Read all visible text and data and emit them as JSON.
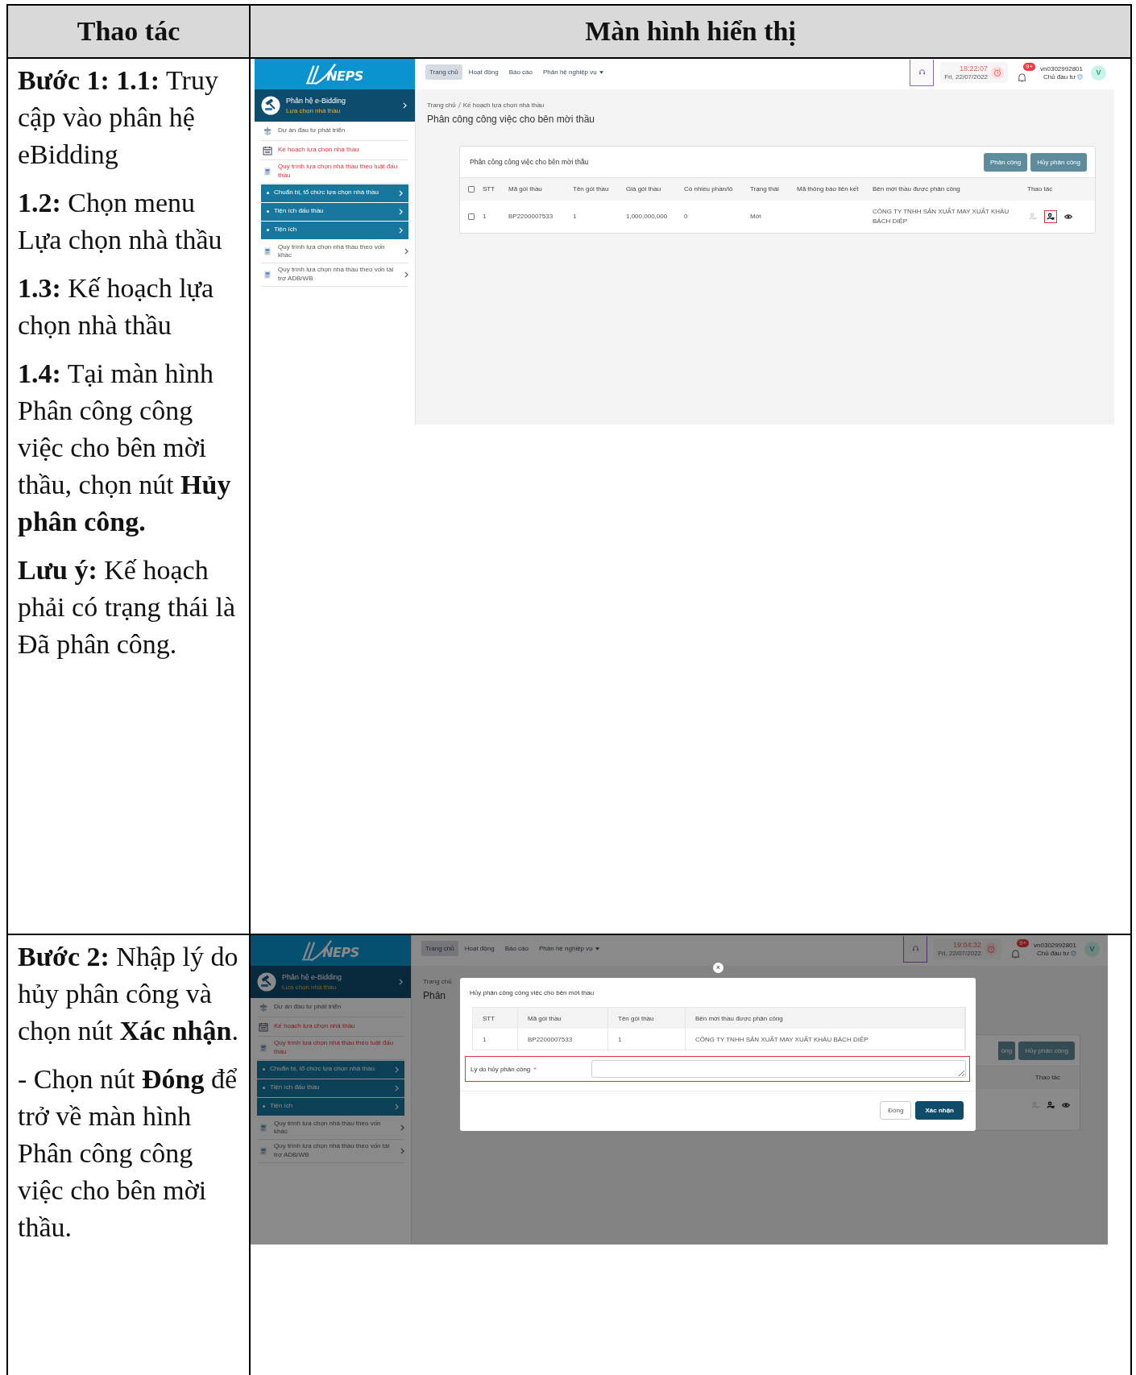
{
  "table": {
    "columns": [
      "Thao tác",
      "Màn hình hiển thị"
    ],
    "rows": [
      {
        "instructions": [
          "**Bước 1: 1.1:** Truy cập vào phân hệ eBidding",
          "**1.2:** Chọn menu Lựa chọn nhà thầu",
          "**1.3:** Kế hoạch lựa chọn nhà thầu",
          "**1.4:** Tại màn hình Phân công công việc cho bên mời thầu, chọn nút **Hủy phân công.**",
          "**Lưu ý:**  Kế hoạch phải có trạng thái là Đã phân công."
        ],
        "screen": {
          "kind": "page",
          "logo": "NEPS",
          "nav": [
            {
              "label": "Trang chủ",
              "selected": true,
              "dropdown": false
            },
            {
              "label": "Hoạt động",
              "selected": false,
              "dropdown": false
            },
            {
              "label": "Báo cáo",
              "selected": false,
              "dropdown": false
            },
            {
              "label": "Phân hệ nghiệp vụ",
              "selected": false,
              "dropdown": true
            }
          ],
          "time": "18:22:07",
          "date": "Fri, 22/07/2022",
          "notifications": "9+",
          "user": "vn0302992801",
          "role": "Chủ đầu tư",
          "avatar": "V",
          "module": {
            "title": "Phân hệ e-Bidding",
            "subtitle": "Lựa chọn nhà thầu"
          },
          "sidebar": [
            {
              "label": "Dự án đầu tư phát triển",
              "kind": "link",
              "selected": false
            },
            {
              "label": "Kế hoạch lựa chọn nhà thầu",
              "kind": "link",
              "selected": true
            },
            {
              "label": "Quy trình lựa chọn nhà thầu theo luật đấu thầu",
              "kind": "group",
              "selected": true,
              "expanded": true,
              "children": [
                {
                  "label": "Chuẩn bị, tổ chức lựa chọn nhà thầu"
                },
                {
                  "label": "Tiện ích đấu thầu"
                },
                {
                  "label": "Tiện ích"
                }
              ]
            },
            {
              "label": "Quy trình lựa chọn nhà thầu theo vốn khác",
              "kind": "group",
              "selected": false,
              "expanded": false
            },
            {
              "label": "Quy trình lựa chọn nhà thầu theo vốn tài trợ ADB/WB",
              "kind": "group",
              "selected": false,
              "expanded": false
            }
          ],
          "breadcrumb": [
            "Trang chủ",
            "Kế hoạch lựa chọn nhà thầu"
          ],
          "page_title": "Phân công công việc cho bên mời thầu",
          "card": {
            "title": "Phân công công việc cho bên mời thầu",
            "buttons": [
              "Phân công",
              "Hủy phân công"
            ],
            "select_all": false,
            "columns": [
              "STT",
              "Mã gói thầu",
              "Tên gói thầu",
              "Giá gói thầu",
              "Có nhiều phần/lô",
              "Trạng thái",
              "Mã thông báo liên kết",
              "Bên mời thầu được phân công",
              "Thao tác"
            ],
            "rows": [
              {
                "checked": false,
                "cells": [
                  "1",
                  "BP2200007533",
                  "1",
                  "1,000,000,000",
                  "0",
                  "Mới",
                  null,
                  "CÔNG TY TNHH SẢN XUẤT MAY XUẤT KHẨU BÁCH DIỆP"
                ],
                "actions": [
                  {
                    "kind": "assign",
                    "disabled": true,
                    "highlighted": false
                  },
                  {
                    "kind": "unassign",
                    "disabled": false,
                    "highlighted": true
                  },
                  {
                    "kind": "view",
                    "disabled": false,
                    "highlighted": false
                  }
                ]
              }
            ]
          }
        }
      },
      {
        "instructions": [
          "**Bước 2:** Nhập lý do hủy phân công và chọn nút **Xác nhận**.",
          "- Chọn nút **Đóng** để trở về màn hình Phân công công việc cho bên mời thầu."
        ],
        "screen": {
          "kind": "dialog",
          "logo": "NEPS",
          "nav": [
            {
              "label": "Trang chủ",
              "selected": true,
              "dropdown": false
            },
            {
              "label": "Hoạt động",
              "selected": false,
              "dropdown": false
            },
            {
              "label": "Báo cáo",
              "selected": false,
              "dropdown": false
            },
            {
              "label": "Phân hệ nghiệp vụ",
              "selected": false,
              "dropdown": true
            }
          ],
          "time": "19:04:32",
          "date": "Fri, 22/07/2022",
          "notifications": "9+",
          "user": "vn0302992801",
          "role": "Chủ đầu tư",
          "avatar": "V",
          "module": {
            "title": "Phân hệ e-Bidding",
            "subtitle": "Lựa chọn nhà thầu"
          },
          "sidebar": [
            {
              "label": "Dự án đầu tư phát triển",
              "kind": "link",
              "selected": false
            },
            {
              "label": "Kế hoạch lựa chọn nhà thầu",
              "kind": "link",
              "selected": true
            },
            {
              "label": "Quy trình lựa chọn nhà thầu theo luật đấu thầu",
              "kind": "group",
              "selected": true,
              "expanded": true,
              "children": [
                {
                  "label": "Chuẩn bị, tổ chức lựa chọn nhà thầu"
                },
                {
                  "label": "Tiện ích đấu thầu"
                },
                {
                  "label": "Tiện ích"
                }
              ]
            },
            {
              "label": "Quy trình lựa chọn nhà thầu theo vốn khác",
              "kind": "group",
              "selected": false,
              "expanded": false
            },
            {
              "label": "Quy trình lựa chọn nhà thầu theo vốn tài trợ ADB/WB",
              "kind": "group",
              "selected": false,
              "expanded": false
            }
          ],
          "breadcrumb": [
            "Trang chủ"
          ],
          "page_title": "Phân",
          "card": {
            "buttons": [
              "ông",
              "Hủy phân công"
            ],
            "columns": [
              "Thao tác"
            ],
            "rows": [
              {
                "actions": [
                  {
                    "kind": "assign",
                    "disabled": true,
                    "highlighted": false
                  },
                  {
                    "kind": "unassign",
                    "disabled": false,
                    "highlighted": false
                  },
                  {
                    "kind": "view",
                    "disabled": false,
                    "highlighted": false
                  }
                ]
              }
            ]
          },
          "modal": {
            "close": "×",
            "title": "Hủy phân công công việc cho bên mời thầu",
            "columns": [
              "STT",
              "Mã gói thầu",
              "Tên gói thầu",
              "Bên mời thầu được phân công"
            ],
            "rows": [
              [
                "1",
                "BP2200007533",
                "1",
                "CÔNG TY TNHH SẢN XUẤT MAY XUẤT KHẨU BÁCH DIỆP"
              ]
            ],
            "field": {
              "label": "Lý do hủy phân công",
              "required_mark": "*",
              "highlighted": true
            },
            "buttons": [
              {
                "label": "Đóng",
                "kind": "secondary"
              },
              {
                "label": "Xác nhận",
                "kind": "primary"
              }
            ]
          }
        }
      }
    ]
  }
}
